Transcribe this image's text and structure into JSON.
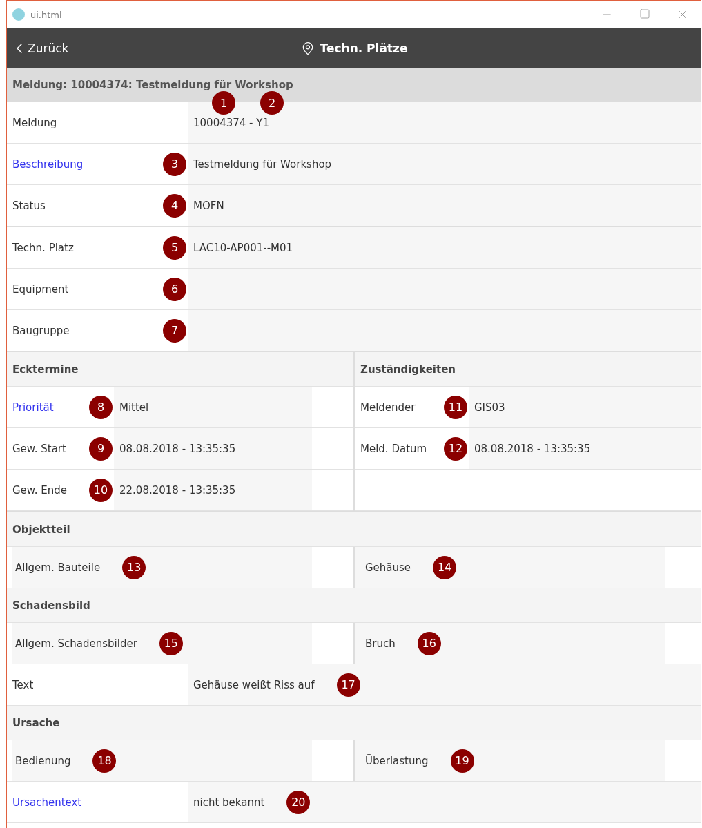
{
  "title_bar": {
    "title": "ui.html"
  },
  "header": {
    "back": "Zurück",
    "title": "Techn. Plätze"
  },
  "notification": {
    "title": "Meldung: 10004374: Testmeldung für Workshop",
    "rows": [
      {
        "label": "Meldung",
        "value": "10004374 - Y1",
        "link": false,
        "markers": [
          "1",
          "2"
        ]
      },
      {
        "label": "Beschreibung",
        "value": "Testmeldung für Workshop",
        "link": true,
        "markers": [
          "3"
        ]
      },
      {
        "label": "Status",
        "value": "MOFN",
        "link": false,
        "markers": [
          "4"
        ]
      }
    ]
  },
  "location": {
    "rows": [
      {
        "label": "Techn. Platz",
        "value": "LAC10-AP001--M01",
        "link": false,
        "markers": [
          "5"
        ]
      },
      {
        "label": "Equipment",
        "link": false,
        "markers": [
          "6"
        ]
      },
      {
        "label": "Baugruppe",
        "link": false,
        "markers": [
          "7"
        ]
      }
    ]
  },
  "dates": {
    "title": "Ecktermine",
    "rows": [
      {
        "label": "Priorität",
        "value": "Mittel",
        "link": true,
        "marker": "8"
      },
      {
        "label": "Gew. Start",
        "value": "08.08.2018 - 13:35:35",
        "link": false,
        "marker": "9"
      },
      {
        "label": "Gew. Ende",
        "value": "22.08.2018 - 13:35:35",
        "link": false,
        "marker": "10"
      }
    ]
  },
  "responsibilities": {
    "title": "Zuständigkeiten",
    "rows": [
      {
        "label": "Meldender",
        "value": "GIS03",
        "link": false,
        "marker": "11"
      },
      {
        "label": "Meld. Datum",
        "value": "08.08.2018 - 13:35:35",
        "link": false,
        "marker": "12"
      }
    ]
  },
  "object_part": {
    "title": "Objektteil",
    "items": [
      {
        "label": "Allgem. Bauteile",
        "marker": "13"
      },
      {
        "label": "Gehäuse",
        "marker": "14"
      }
    ]
  },
  "damage": {
    "title": "Schadensbild",
    "items": [
      {
        "label": "Allgem. Schadensbilder",
        "marker": "15"
      },
      {
        "label": "Bruch",
        "marker": "16"
      }
    ],
    "text_row": {
      "label": "Text",
      "value": "Gehäuse weißt Riss auf",
      "link": false,
      "marker": "17"
    }
  },
  "cause": {
    "title": "Ursache",
    "items": [
      {
        "label": "Bedienung",
        "marker": "18"
      },
      {
        "label": "Überlastung",
        "marker": "19"
      }
    ],
    "text_row": {
      "label": "Ursachentext",
      "value": "nicht bekannt",
      "link": true,
      "marker": "20"
    }
  }
}
